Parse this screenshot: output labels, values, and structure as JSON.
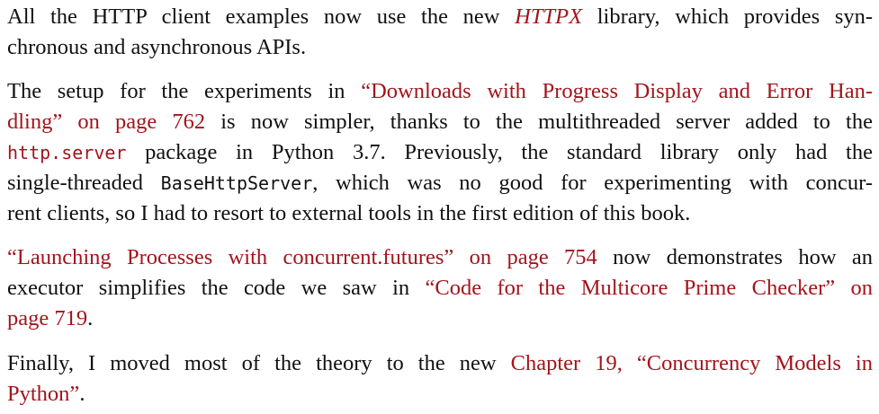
{
  "colors": {
    "text": "#111111",
    "link": "#a3141c",
    "background": "#ffffff"
  },
  "p1": {
    "l1_a": "All the HTTP client examples now use the new ",
    "l1_link": "HTTPX",
    "l1_b": " library, which provides syn-",
    "l2": "chronous and asynchronous APIs."
  },
  "p2": {
    "l1_a": "The setup for the experiments in ",
    "l1_link": "“Downloads with Progress Display and Error Han-",
    "l2_link": "dling” on page 762",
    "l2_b": " is now simpler, thanks to the multithreaded server added to the",
    "l3_code": "http.server",
    "l3_b": " package in Python 3.7. Previously, the standard library only had the",
    "l4_a": "single-threaded ",
    "l4_code": "BaseHttpServer",
    "l4_b": ", which was no good for experimenting with concur-",
    "l5": "rent clients, so I had to resort to external tools in the first edition of this book."
  },
  "p3": {
    "l1_link": "“Launching Processes with concurrent.futures” on page 754",
    "l1_b": " now demonstrates how an",
    "l2_a": "executor simplifies the code we saw in ",
    "l2_link": "“Code for the Multicore Prime Checker” on",
    "l3_link": "page 719",
    "l3_b": "."
  },
  "p4": {
    "l1_a": "Finally, I moved most of the theory to the new ",
    "l1_link": "Chapter 19, “Concurrency Models in",
    "l2_link": "Python”",
    "l2_b": "."
  }
}
